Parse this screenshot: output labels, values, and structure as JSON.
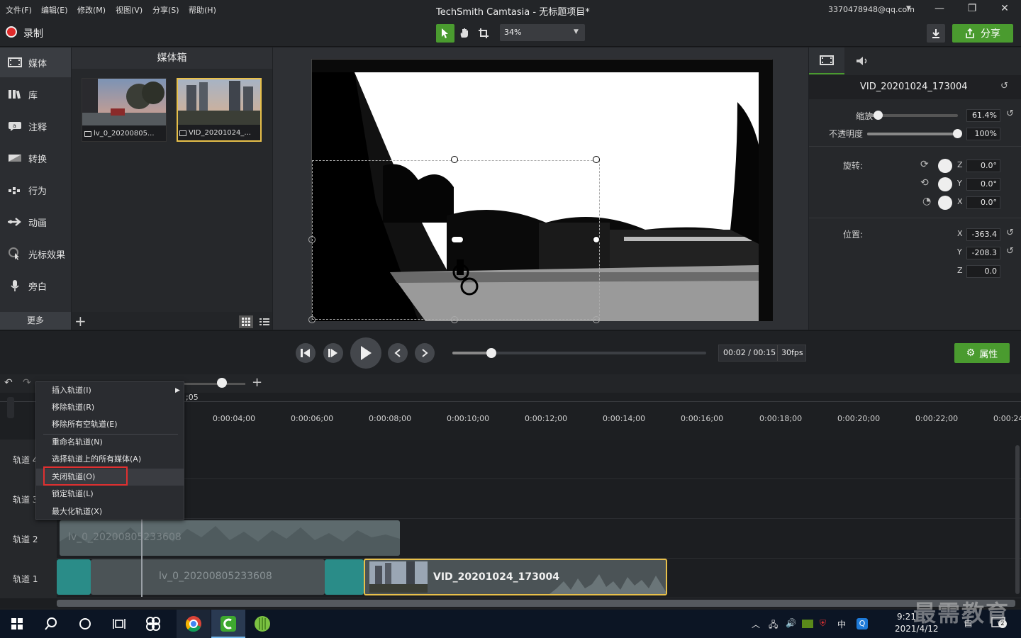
{
  "menu": [
    "文件(F)",
    "编辑(E)",
    "修改(M)",
    "视图(V)",
    "分享(S)",
    "帮助(H)"
  ],
  "window_title": "TechSmith Camtasia - 无标题项目*",
  "account": "3370478948@qq.com",
  "record_label": "录制",
  "zoom_value": "34%",
  "share_label": "分享",
  "rail": [
    "媒体",
    "库",
    "注释",
    "转换",
    "行为",
    "动画",
    "光标效果",
    "旁白"
  ],
  "rail_more": "更多",
  "bin": {
    "title": "媒体箱",
    "items": [
      {
        "label": "lv_0_20200805..."
      },
      {
        "label": "VID_20201024_..."
      }
    ]
  },
  "props": {
    "clip_name": "VID_20201024_173004",
    "scale_label": "缩放",
    "scale_value": "61.4%",
    "scale_level": 0.12,
    "opacity_label": "不透明度",
    "opacity_value": "100%",
    "opacity_level": 1.0,
    "rotation_label": "旋转:",
    "rot": [
      {
        "axis": "Z",
        "value": "0.0°"
      },
      {
        "axis": "Y",
        "value": "0.0°"
      },
      {
        "axis": "X",
        "value": "0.0°"
      }
    ],
    "position_label": "位置:",
    "pos": [
      {
        "axis": "X",
        "value": "-363.4"
      },
      {
        "axis": "Y",
        "value": "-208.3"
      },
      {
        "axis": "Z",
        "value": "0.0"
      }
    ],
    "attr_button": "属性"
  },
  "playback": {
    "time": "00:02 / 00:15",
    "fps": "30fps",
    "progress": 0.15
  },
  "ruler": {
    "ticks": [
      "0:00:04;00",
      "0:00:06;00",
      "0:00:08;00",
      "0:00:10;00",
      "0:00:12;00",
      "0:00:14;00",
      "0:00:16;00",
      "0:00:18;00",
      "0:00:20;00",
      "0:00:22;00",
      "0:00:24"
    ],
    "partial": ";05"
  },
  "tracks": [
    "轨道 4",
    "轨道 3",
    "轨道 2",
    "轨道 1"
  ],
  "clips": {
    "track2": "lv_0_20200805233608",
    "track1_a": "lv_0_20200805233608",
    "track1_b": "VID_20201024_173004"
  },
  "context_menu": {
    "items": [
      "插入轨道(I)",
      "移除轨道(R)",
      "移除所有空轨道(E)",
      "重命名轨道(N)",
      "选择轨道上的所有媒体(A)",
      "关闭轨道(O)",
      "锁定轨道(L)",
      "最大化轨道(X)"
    ],
    "highlighted": "关闭轨道(O)"
  },
  "taskbar": {
    "time": "9:21",
    "date": "2021/4/12",
    "ime": "中",
    "notifications": "2"
  },
  "watermark": "最需教育",
  "colors": {
    "accent_green": "#4a9b2f",
    "highlight_yellow": "#e8c04a",
    "record_red": "#e02b2b",
    "menu_highlight": "#e03030"
  }
}
